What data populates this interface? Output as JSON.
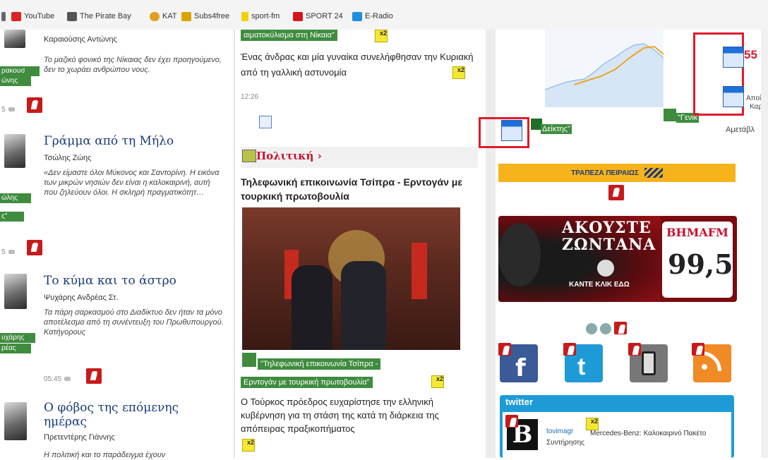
{
  "bookmarks": [
    {
      "label": "",
      "icon": "arrow-icon"
    },
    {
      "label": "YouTube",
      "icon": "youtube-icon"
    },
    {
      "label": "The Pirate Bay",
      "icon": "pirate-ship-icon"
    },
    {
      "label": "KAT",
      "icon": "kat-icon"
    },
    {
      "label": "Subs4free",
      "icon": "subs-icon"
    },
    {
      "label": "sport-fm",
      "icon": "sportfm-icon"
    },
    {
      "label": "SPORT 24",
      "icon": "sport24-icon"
    },
    {
      "label": "E-Radio",
      "icon": "eradio-icon"
    }
  ],
  "left": {
    "top_tag_1": "ρακουσ",
    "top_tag_2": "ώνης",
    "block1": {
      "author": "Καραιούσης Αντώνης",
      "excerpt": "Το μαζικό φονικό της Νίκαιας δεν έχει προηγούμενο, δεν το χωράει ανθρώπου νους."
    },
    "meta1": "5",
    "block2": {
      "title": "Γράμμα από τη Μήλο",
      "author": "Τσώλης Ζώης",
      "excerpt": "«Δεν είμαστε όλοι Μύκονος και Σαντορίνη. Η εικόνα των μικρών νησιών δεν είναι η καλοκαιρινή, αυτή που ζηλεύουν όλοι. Η σκληρή πραγματικότητ…",
      "tag_1": "ώλης",
      "tag_2": "ς\""
    },
    "meta2": "5",
    "block3": {
      "title": "Το κύμα και το άστρο",
      "author": "Ψυχάρης Ανδρέας Στ.",
      "excerpt": "Τα πάρη σαρκασμού στο Διαδίκτυο δεν ήταν τα μόνο αποτέλεσμα από τη συνέντευξη του Πρωθυπουργού. Κατήγορους",
      "tag_1": "υχάρης",
      "tag_2": "ρέας",
      "time": "05:45"
    },
    "block4": {
      "title": "Ο φόβος της επόμενης ημέρας",
      "author": "Πρετεντέρης Γιάννης",
      "excerpt": "Η πολιτική και το παράδειγμα έχουν"
    }
  },
  "middle": {
    "top_caption": "αιματοκύλισμα στη Νίκαια\"",
    "top_badge": "x2",
    "top_headline": "Ένας άνδρας και μία γυναίκα συνελήφθησαν την Κυριακή από τη γαλλική αστυνομία",
    "top_headline_badge": "x2",
    "top_time": "12:26",
    "section_title": "Πολιτική",
    "section_arrow": "›",
    "story_title": "Τηλεφωνική επικοινωνία Τσίπρα - Ερντογάν με τουρκική πρωτοβουλία",
    "caption_line1": "\"Τηλεφωνική επικοινωνία Τσίπρα -",
    "caption_line2": "Ερντογάν με τουρκική πρωτοβουλία\"",
    "caption_badge": "x2",
    "story_excerpt": "Ο Τούρκος πρόεδρος ευχαρίστησε την ελληνική κυβέρνηση για τη στάση της κατά τη διάρκεια της απόπειρας πραξικοπήματος",
    "excerpt_badge": "x2"
  },
  "right": {
    "chart_tag": "Δείκτης\"",
    "chart_tag2": "\"Γενικ",
    "win_number": "55",
    "side_text_1": "Αποί",
    "side_text_2": "Καροί",
    "side_text_3": "Αμετάβλ",
    "bank_label": "ΤΡΑΠΕΖΑ ΠΕΙΡΑΙΩΣ",
    "radio": {
      "line1": "ΑΚΟΥΣΤΕ",
      "line2": "ΖΩΝΤΑΝΑ",
      "brand": "ΒΗΜΑFM",
      "freq": "99,5",
      "cta": "ΚΑΝΤΕ ΚΛΙΚ ΕΔΩ"
    },
    "social": [
      "facebook-icon",
      "twitter-icon",
      "mobile-icon",
      "rss-icon"
    ],
    "twitter": {
      "header": "twitter",
      "user": "tovimagr",
      "tweet": "Mercedes-Benz: Καλοκαιρινό Πακέτο Συντήρησης",
      "badge": "x2"
    }
  },
  "colors": {
    "accent_red": "#e01b2f",
    "link_blue": "#1a3c78",
    "tag_green": "#3f8c3f",
    "badge_yellow": "#f6e832",
    "twitter_teal": "#1e9bd7"
  }
}
